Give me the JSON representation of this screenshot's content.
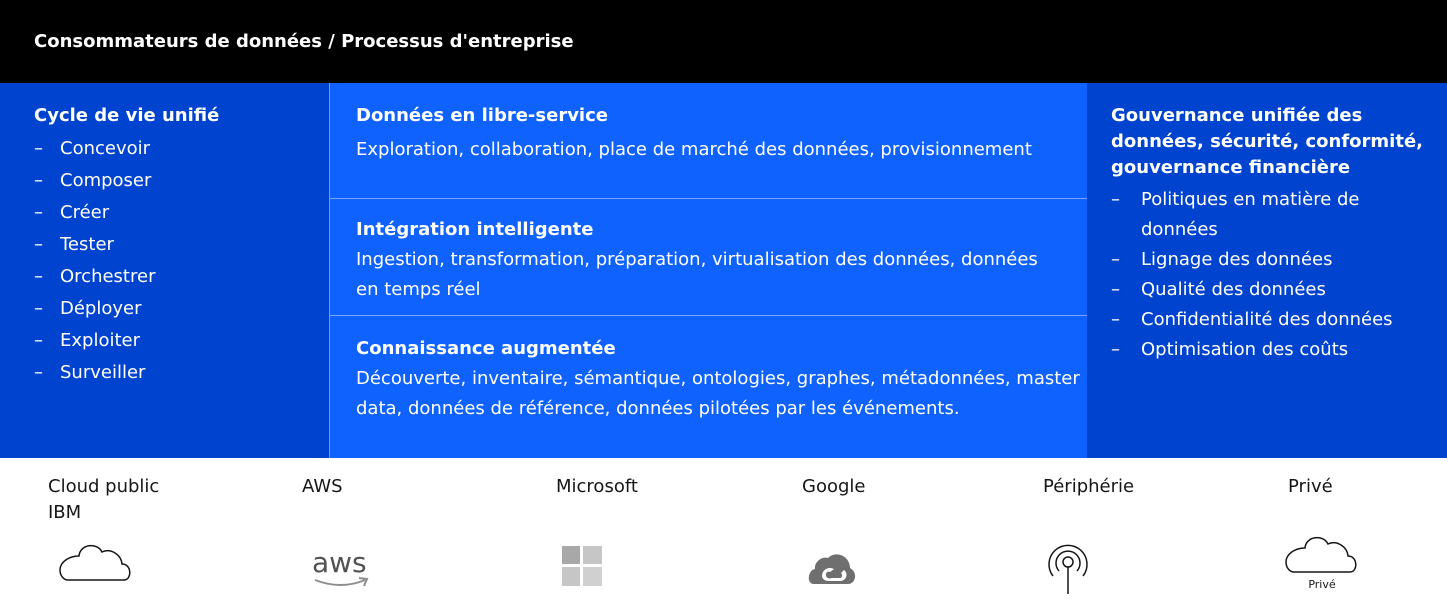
{
  "header": {
    "title": "Consommateurs de données / Processus d'entreprise"
  },
  "lifecycle": {
    "title": "Cycle de vie unifié",
    "items": [
      "Concevoir",
      "Composer",
      "Créer",
      "Tester",
      "Orchestrer",
      "Déployer",
      "Exploiter",
      "Surveiller"
    ]
  },
  "middle": {
    "sections": [
      {
        "title": "Données en libre-service",
        "desc": "Exploration, collaboration, place de marché des données, provisionnement"
      },
      {
        "title": "Intégration intelligente",
        "desc": "Ingestion, transformation, préparation, virtualisation des données, données en temps réel"
      },
      {
        "title": "Connaissance augmentée",
        "desc": "Découverte, inventaire, sémantique, ontologies, graphes, métadonnées, master data, données de référence, données pilotées par les événements."
      }
    ]
  },
  "governance": {
    "title": "Gouvernance unifiée des données, sécurité, conformité, gouvernance financière",
    "items": [
      "Politiques en matière de données",
      "Lignage des données",
      "Qualité des données",
      "Confidentialité des données",
      "Optimisation des coûts"
    ]
  },
  "providers": [
    {
      "label": "Cloud public IBM",
      "icon": "cloud-icon"
    },
    {
      "label": "AWS",
      "icon": "aws-logo-icon",
      "icon_text": "aws"
    },
    {
      "label": "Microsoft",
      "icon": "windows-logo-icon"
    },
    {
      "label": "Google",
      "icon": "google-cloud-icon"
    },
    {
      "label": "Périphérie",
      "icon": "edge-antenna-icon"
    },
    {
      "label": "Privé",
      "icon": "private-cloud-icon",
      "icon_text": "Privé"
    }
  ],
  "colors": {
    "header_bg": "#000000",
    "side_bg": "#0043ce",
    "mid_bg": "#0f62fe",
    "text_on_blue": "#ffffff"
  }
}
